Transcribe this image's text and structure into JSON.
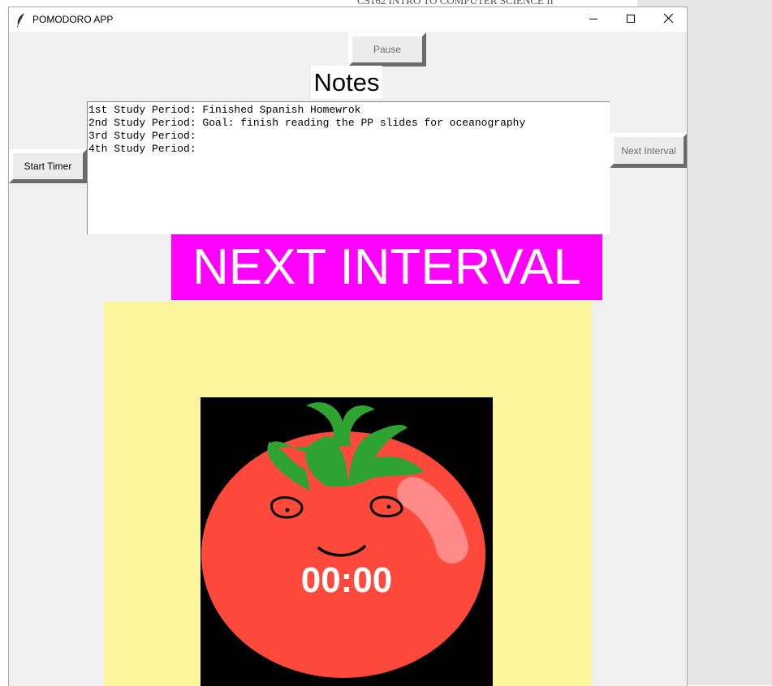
{
  "background_window": {
    "title": "CS162 INTRO TO COMPUTER SCIENCE II"
  },
  "window": {
    "title": "POMODORO APP"
  },
  "buttons": {
    "pause": "Pause",
    "start_timer": "Start Timer",
    "next_interval": "Next Interval"
  },
  "notes": {
    "label": "Notes",
    "lines": [
      "1st Study Period: Finished Spanish Homewrok",
      "2nd Study Period: Goal: finish reading the PP slides for oceanography",
      "3rd Study Period:",
      "4th Study Period:"
    ]
  },
  "banner": {
    "text": "NEXT INTERVAL",
    "color": "#ff00ff"
  },
  "timer": {
    "display": "00:00"
  },
  "colors": {
    "panel": "#fbf59b",
    "tomato": "#ff4a3b",
    "leaf": "#2ea330",
    "highlight": "#ff8a88",
    "canvas": "#000000"
  }
}
